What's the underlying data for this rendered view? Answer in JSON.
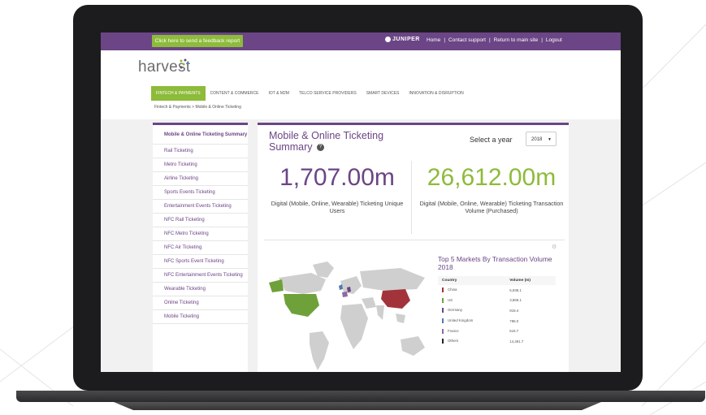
{
  "topbar": {
    "feedback_label": "Click here to send a feedback report",
    "brand": "JUNIPER",
    "nav": [
      "Home",
      "Contact support",
      "Return to main site",
      "Logout"
    ]
  },
  "header": {
    "logo": "harvest",
    "nav": [
      "FINTECH & PAYMENTS",
      "CONTENT & COMMERCE",
      "IOT & M2M",
      "TELCO SERVICE PROVIDERS",
      "SMART DEVICES",
      "INNOVATION & DISRUPTION"
    ],
    "breadcrumb": "Fintech & Payments > Mobile & Online Ticketing"
  },
  "sidebar": {
    "items": [
      "Mobile & Online Ticketing Summary",
      "Rail Ticketing",
      "Metro Ticketing",
      "Airline Ticketing",
      "Sports Events Ticketing",
      "Entertainment Events Ticketing",
      "NFC Rail Ticketing",
      "NFC Metro Ticketing",
      "NFC Air Ticketing",
      "NFC Sports Event Ticketing",
      "NFC Entertainment Events Ticketing",
      "Wearable Ticketing",
      "Online Ticketing",
      "Mobile Ticketing"
    ]
  },
  "main": {
    "title": "Mobile & Online Ticketing Summary",
    "year_label": "Select a year",
    "year_value": "2018",
    "stat1_value": "1,707.00m",
    "stat1_label": "Digital (Mobile, Online, Wearable) Ticketing Unique Users",
    "stat2_value": "26,612.00m",
    "stat2_label": "Digital (Mobile, Online, Wearable) Ticketing Transaction Volume (Purchased)"
  },
  "markets": {
    "title": "Top 5 Markets By Transaction Volume 2018",
    "col_country": "Country",
    "col_volume": "Volume (m)",
    "rows": [
      {
        "country": "China",
        "volume": "5,938.1",
        "color": "#a2333b"
      },
      {
        "country": "US",
        "volume": "3,869.1",
        "color": "#6fa13a"
      },
      {
        "country": "Germany",
        "volume": "919.4",
        "color": "#6b4585"
      },
      {
        "country": "United Kingdom",
        "volume": "786.0",
        "color": "#4f7ab3"
      },
      {
        "country": "France",
        "volume": "616.7",
        "color": "#8c6aa6"
      },
      {
        "country": "Others",
        "volume": "14,491.7",
        "color": "#222222"
      }
    ]
  },
  "colors": {
    "purple": "#6b4585",
    "green": "#8dbb3a"
  }
}
